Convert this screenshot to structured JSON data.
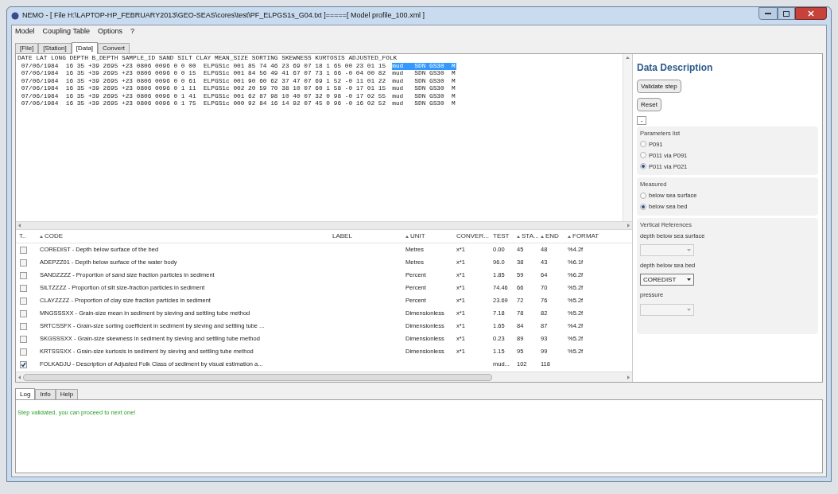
{
  "window": {
    "title": "NEMO - [ File H:\\LAPTOP-HP_FEBRUARY2013\\GEO-SEAS\\cores\\test\\PF_ELPGS1s_G04.txt ]=====[ Model profile_100.xml ]"
  },
  "menu": [
    "Model",
    "Coupling Table",
    "Options",
    "?"
  ],
  "tabs": [
    {
      "label": "[File]",
      "selected": false
    },
    {
      "label": "[Station]",
      "selected": false
    },
    {
      "label": "[Data]",
      "selected": true
    },
    {
      "label": "Convert",
      "selected": false
    }
  ],
  "file_view": {
    "header": "DATE LAT LONG DEPTH B_DEPTH SAMPLE_ID SAND SILT CLAY MEAN_SIZE SORTING SKEWNESS KURTOSIS ADJUSTED_FOLK",
    "lines": [
      {
        "text": " 07/06/1984  16 35 +39 2695 +23 0806 0096 0 0 00  ELPGS1c 001 85 74 46 23 69 07 18 1 65 00 23 01 15",
        "tail": "mud   SDN GS30  M",
        "selected": true
      },
      {
        "text": " 07/06/1984  16 35 +39 2695 +23 0806 0096 0 0 15  ELPGS1c 001 84 56 49 41 67 07 73 1 66 -0 04 00 82",
        "tail": "mud   SDN GS30  M",
        "selected": false
      },
      {
        "text": " 07/06/1984  16 35 +39 2695 +23 0806 0096 0 0 61  ELPGS1c 001 90 60 62 37 47 07 69 1 52 -0 11 01 22",
        "tail": "mud   SDN GS30  M",
        "selected": false
      },
      {
        "text": " 07/06/1984  16 35 +39 2695 +23 0806 0096 0 1 11  ELPGS1c 002 20 59 70 38 10 07 60 1 58 -0 17 01 15",
        "tail": "mud   SDN GS30  M",
        "selected": false
      },
      {
        "text": " 07/06/1984  16 35 +39 2695 +23 0806 0096 0 1 41  ELPGS1c 001 62 87 98 10 40 07 32 0 98 -0 17 02 55",
        "tail": "mud   SDN GS30  M",
        "selected": false
      },
      {
        "text": " 07/06/1984  16 35 +39 2695 +23 0806 0096 0 1 75  ELPGS1c 000 92 84 16 14 92 07 45 0 96 -0 16 02 52",
        "tail": "mud   SDN GS30  M",
        "selected": false
      }
    ]
  },
  "table": {
    "columns": [
      {
        "label": "T..",
        "sorted": false
      },
      {
        "label": "CODE",
        "sorted": true
      },
      {
        "label": "LABEL",
        "sorted": false
      },
      {
        "label": "UNIT",
        "sorted": true
      },
      {
        "label": "CONVER...",
        "sorted": false
      },
      {
        "label": "TEST",
        "sorted": false
      },
      {
        "label": "STA...",
        "sorted": true
      },
      {
        "label": "END",
        "sorted": true
      },
      {
        "label": "FORMAT",
        "sorted": true
      }
    ],
    "rows": [
      {
        "checked": false,
        "code": "COREDIST - Depth below surface of the bed",
        "unit": "Metres",
        "conversion": "x*1",
        "test": "0.00",
        "start": "45",
        "end": "48",
        "format": "%4.2f"
      },
      {
        "checked": false,
        "code": "ADEPZZ01 - Depth below surface of the water body",
        "unit": "Metres",
        "conversion": "x*1",
        "test": "96.0",
        "start": "38",
        "end": "43",
        "format": "%6.1f"
      },
      {
        "checked": false,
        "code": "SANDZZZZ - Proportion of sand size fraction particles in sediment",
        "unit": "Percent",
        "conversion": "x*1",
        "test": "1.85",
        "start": "59",
        "end": "64",
        "format": "%6.2f"
      },
      {
        "checked": false,
        "code": "SILTZZZZ - Proportion of silt size-fraction particles in sediment",
        "unit": "Percent",
        "conversion": "x*1",
        "test": "74.46",
        "start": "66",
        "end": "70",
        "format": "%5.2f"
      },
      {
        "checked": false,
        "code": "CLAYZZZZ - Proportion of clay size fraction particles in sediment",
        "unit": "Percent",
        "conversion": "x*1",
        "test": "23.69",
        "start": "72",
        "end": "76",
        "format": "%5.2f"
      },
      {
        "checked": false,
        "code": "MNGSSSXX - Grain-size mean in sediment by sieving and settling tube method",
        "unit": "Dimensionless",
        "conversion": "x*1",
        "test": "7.18",
        "start": "78",
        "end": "82",
        "format": "%5.2f"
      },
      {
        "checked": false,
        "code": "SRTCSSFX - Grain-size sorting coefficient in sediment by sieving and settling tube ...",
        "unit": "Dimensionless",
        "conversion": "x*1",
        "test": "1.65",
        "start": "84",
        "end": "87",
        "format": "%4.2f"
      },
      {
        "checked": false,
        "code": "SKGSSSXX - Grain-size skewness in sediment by sieving and settling tube method",
        "unit": "Dimensionless",
        "conversion": "x*1",
        "test": "0.23",
        "start": "89",
        "end": "93",
        "format": "%5.2f"
      },
      {
        "checked": false,
        "code": "KRTSSSXX - Grain-size kurtosis in sediment by sieving and settling tube method",
        "unit": "Dimensionless",
        "conversion": "x*1",
        "test": "1.15",
        "start": "95",
        "end": "99",
        "format": "%5.2f"
      },
      {
        "checked": true,
        "code": "FOLKADJU - Description of Adjusted Folk Class of sediment by visual estimation a...",
        "test": "mud...",
        "start": "102",
        "end": "118"
      }
    ]
  },
  "panel": {
    "title": "Data Description",
    "buttons": [
      "Validate step",
      "Reset"
    ],
    "collapse": "-",
    "groups": [
      {
        "title": "Parameters list",
        "options": [
          {
            "label": "P091",
            "selected": false
          },
          {
            "label": "P011 via P091",
            "selected": false
          },
          {
            "label": "P011 via P021",
            "selected": true
          }
        ]
      },
      {
        "title": "Measured",
        "options": [
          {
            "label": "below sea surface",
            "selected": false
          },
          {
            "label": "below sea bed",
            "selected": true
          }
        ]
      }
    ],
    "references": {
      "title": "Vertical References",
      "selects": [
        {
          "label": "depth below sea surface",
          "disabled": true
        },
        {
          "label": "depth below sea bed",
          "value": "COREDIST",
          "disabled": false
        },
        {
          "label": "pressure",
          "disabled": true
        }
      ]
    }
  },
  "log": {
    "tabs": [
      {
        "label": "Log",
        "selected": true
      },
      {
        "label": "Info",
        "selected": false
      },
      {
        "label": "Help",
        "selected": false
      }
    ],
    "message": "Step validated, you can proceed to next one!"
  }
}
